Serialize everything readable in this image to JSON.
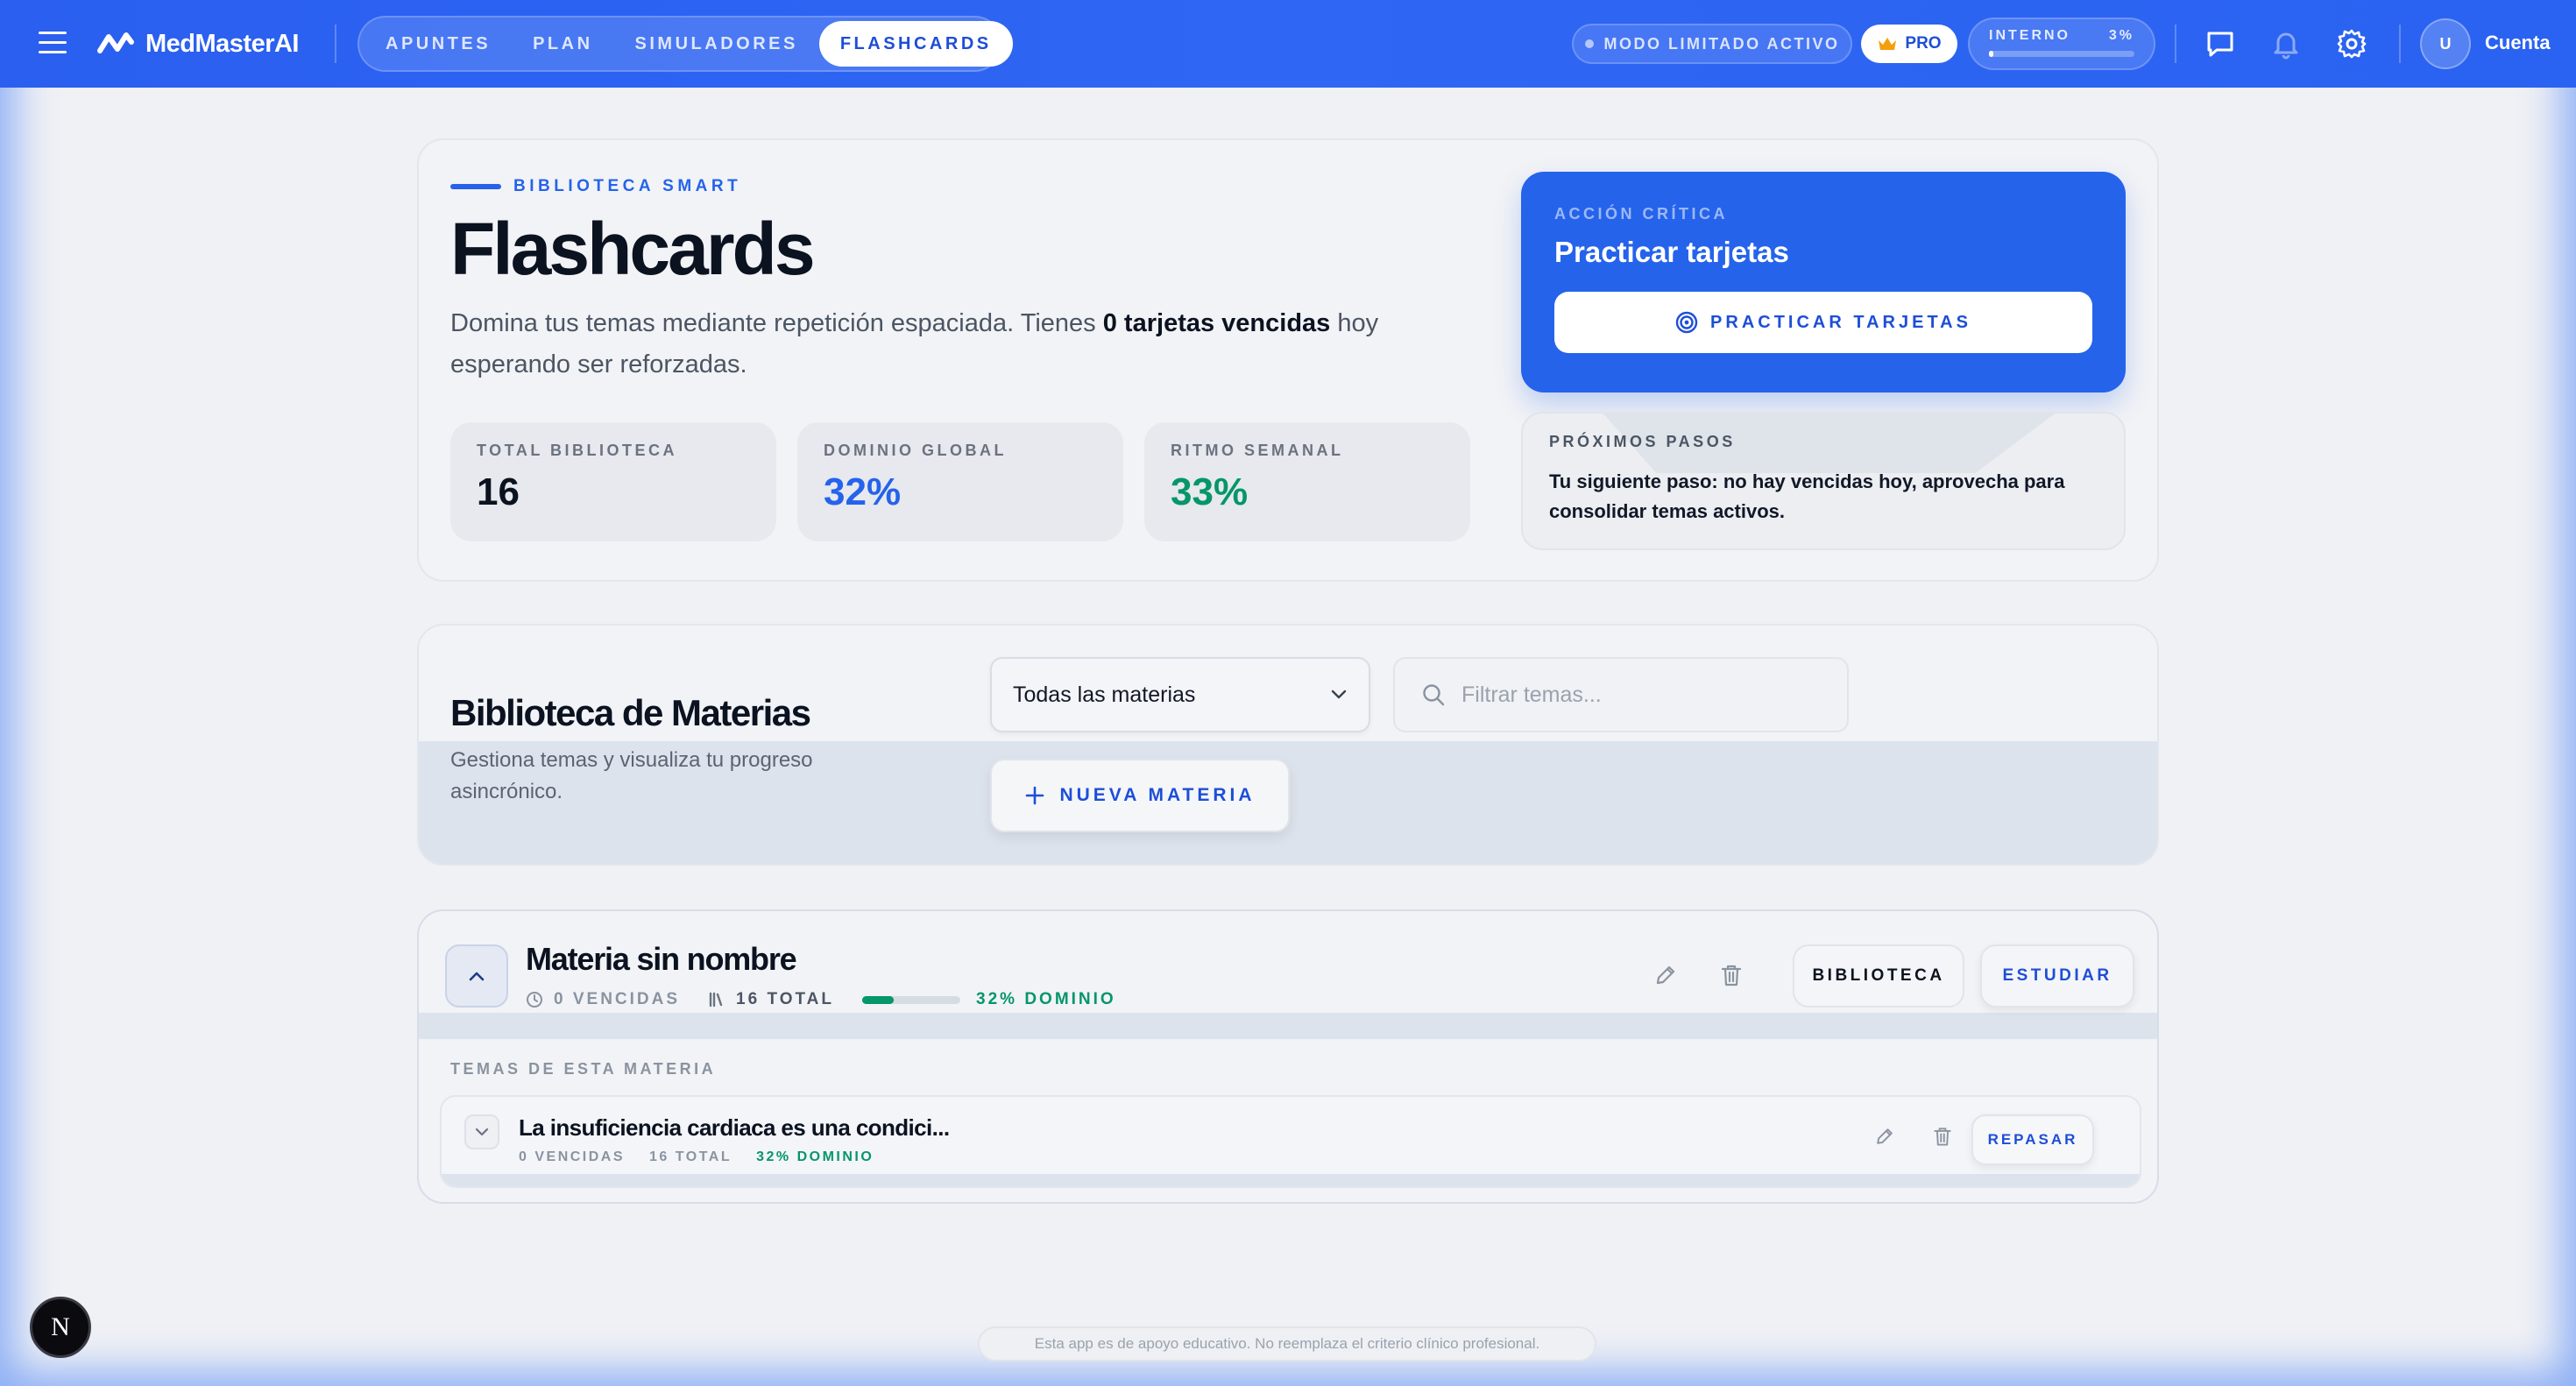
{
  "nav": {
    "brand": "MedMasterAI",
    "tabs": [
      {
        "label": "APUNTES"
      },
      {
        "label": "PLAN"
      },
      {
        "label": "SIMULADORES"
      },
      {
        "label": "FLASHCARDS",
        "active": true
      }
    ],
    "modo_label": "MODO LIMITADO ACTIVO",
    "pro_label": "PRO",
    "interno_label": "INTERNO",
    "interno_percent_label": "3%",
    "interno_progress": 0.03,
    "avatar_initial": "U",
    "account_label": "Cuenta",
    "icons": [
      "menu-icon",
      "brand-logo-icon",
      "crown-icon",
      "chat-icon",
      "bell-icon",
      "gear-icon"
    ]
  },
  "hero": {
    "eyebrow": "BIBLIOTECA SMART",
    "title": "Flashcards",
    "desc_prefix": "Domina tus temas mediante repetición espaciada. Tienes ",
    "desc_bold": "0 tarjetas vencidas",
    "desc_suffix": " hoy esperando ser reforzadas.",
    "stats": [
      {
        "label": "TOTAL BIBLIOTECA",
        "value": "16",
        "color": "#0b1220"
      },
      {
        "label": "DOMINIO GLOBAL",
        "value": "32%",
        "color": "#2563eb"
      },
      {
        "label": "RITMO SEMANAL",
        "value": "33%",
        "color": "#059669"
      }
    ],
    "critical": {
      "eyebrow": "ACCIÓN CRÍTICA",
      "title": "Practicar tarjetas",
      "button_label": "PRACTICAR TARJETAS"
    },
    "next_steps": {
      "label": "PRÓXIMOS PASOS",
      "text": "Tu siguiente paso: no hay vencidas hoy, aprovecha para consolidar temas activos."
    }
  },
  "library": {
    "title": "Biblioteca de Materias",
    "desc": "Gestiona temas y visualiza tu progreso asincrónico.",
    "select_value": "Todas las materias",
    "search_placeholder": "Filtrar temas...",
    "new_button_label": "NUEVA MATERIA"
  },
  "materia": {
    "title": "Materia sin nombre",
    "vencidas": "0 VENCIDAS",
    "total": "16 TOTAL",
    "dominio": "32% DOMINIO",
    "dominio_progress": 0.32,
    "biblioteca_label": "BIBLIOTECA",
    "estudiar_label": "ESTUDIAR",
    "temas_label": "TEMAS DE ESTA MATERIA",
    "temas": [
      {
        "title": "La insuficiencia cardiaca es una condici...",
        "vencidas": "0 VENCIDAS",
        "total": "16 TOTAL",
        "dominio": "32% DOMINIO",
        "action_label": "REPASAR"
      }
    ]
  },
  "footer": {
    "disclaimer": "Esta app es de apoyo educativo. No reemplaza el criterio clínico profesional.",
    "badge_letter": "N"
  },
  "colors": {
    "nav_blue": "#2f66f3",
    "primary": "#2563eb",
    "success": "#059669"
  }
}
